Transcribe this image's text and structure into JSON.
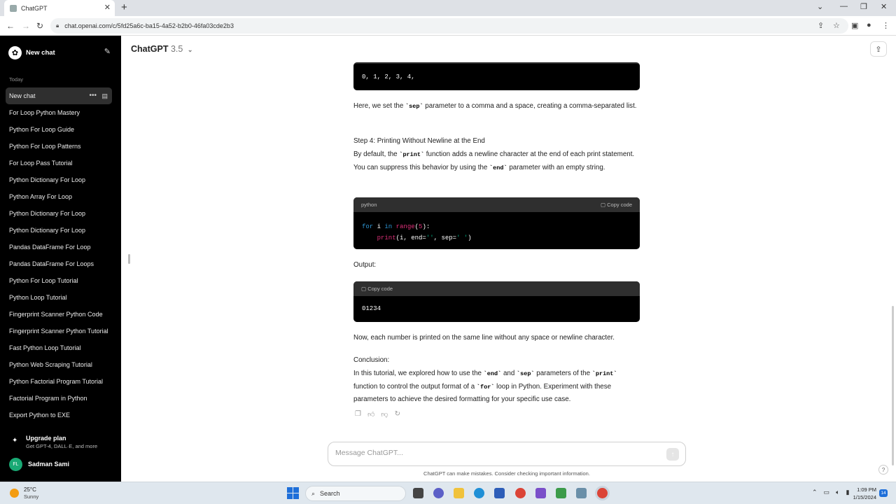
{
  "browser": {
    "tab_title": "ChatGPT",
    "url": "chat.openai.com/c/5fd25a6c-ba15-4a52-b2b0-46fa03cde2b3"
  },
  "sidebar": {
    "new_chat_label": "New chat",
    "section_label": "Today",
    "items": [
      {
        "label": "New chat"
      },
      {
        "label": "For Loop Python Mastery"
      },
      {
        "label": "Python For Loop Guide"
      },
      {
        "label": "Python For Loop Patterns"
      },
      {
        "label": "For Loop Pass Tutorial"
      },
      {
        "label": "Python Dictionary For Loop"
      },
      {
        "label": "Python Array For Loop"
      },
      {
        "label": "Python Dictionary For Loop"
      },
      {
        "label": "Python Dictionary For Loop"
      },
      {
        "label": "Pandas DataFrame For Loop"
      },
      {
        "label": "Pandas DataFrame For Loops"
      },
      {
        "label": "Python For Loop Tutorial"
      },
      {
        "label": "Python Loop Tutorial"
      },
      {
        "label": "Fingerprint Scanner Python Code"
      },
      {
        "label": "Fingerprint Scanner Python Tutorial"
      },
      {
        "label": "Fast Python Loop Tutorial"
      },
      {
        "label": "Python Web Scraping Tutorial"
      },
      {
        "label": "Python Factorial Program Tutorial"
      },
      {
        "label": "Factorial Program in Python"
      },
      {
        "label": "Export Python to EXE"
      }
    ],
    "upgrade_title": "Upgrade plan",
    "upgrade_subtitle": "Get GPT-4, DALL·E, and more",
    "user_initials": "FL",
    "user_name": "Sadman Sami"
  },
  "header": {
    "model_name": "ChatGPT",
    "model_version": "3.5"
  },
  "message": {
    "output_block1": "0, 1, 2, 3, 4,",
    "para1_pre": "Here, we set the ",
    "para1_code": "`sep`",
    "para1_post": " parameter to a comma and a space, creating a comma-separated list.",
    "step4_title": "Step 4: Printing Without Newline at the End",
    "para2_a": "By default, the ",
    "para2_code1": "`print`",
    "para2_b": " function adds a newline character at the end of each print statement. You can suppress this behavior by using the ",
    "para2_code2": "`end`",
    "para2_c": " parameter with an empty string.",
    "code_lang": "python",
    "copy_label": "Copy code",
    "code_line1_kw1": "for",
    "code_line1_var": " i ",
    "code_line1_kw2": "in",
    "code_line1_fn": " range",
    "code_line1_open": "(",
    "code_line1_num": "5",
    "code_line1_close": "):",
    "code_line2_fn": "print",
    "code_line2_mid": "(i, end=",
    "code_line2_str1": "''",
    "code_line2_mid2": ", sep=",
    "code_line2_str2": "' '",
    "code_line2_end": ")",
    "output_label": "Output:",
    "output_block2": "01234",
    "para3": "Now, each number is printed on the same line without any space or newline character.",
    "conclusion_title": "Conclusion:",
    "concl_a": "In this tutorial, we explored how to use the ",
    "concl_code1": "`end`",
    "concl_b": " and ",
    "concl_code2": "`sep`",
    "concl_c": " parameters of the ",
    "concl_code3": "`print`",
    "concl_d": " function to control the output format of a ",
    "concl_code4": "`for`",
    "concl_e": " loop in Python. Experiment with these parameters to achieve the desired formatting for your specific use case."
  },
  "composer": {
    "placeholder": "Message ChatGPT...",
    "disclaimer": "ChatGPT can make mistakes. Consider checking important information."
  },
  "taskbar": {
    "temp": "25°C",
    "weather": "Sunny",
    "search_label": "Search",
    "time": "1:09 PM",
    "date": "1/15/2024",
    "notif_count": "14"
  }
}
